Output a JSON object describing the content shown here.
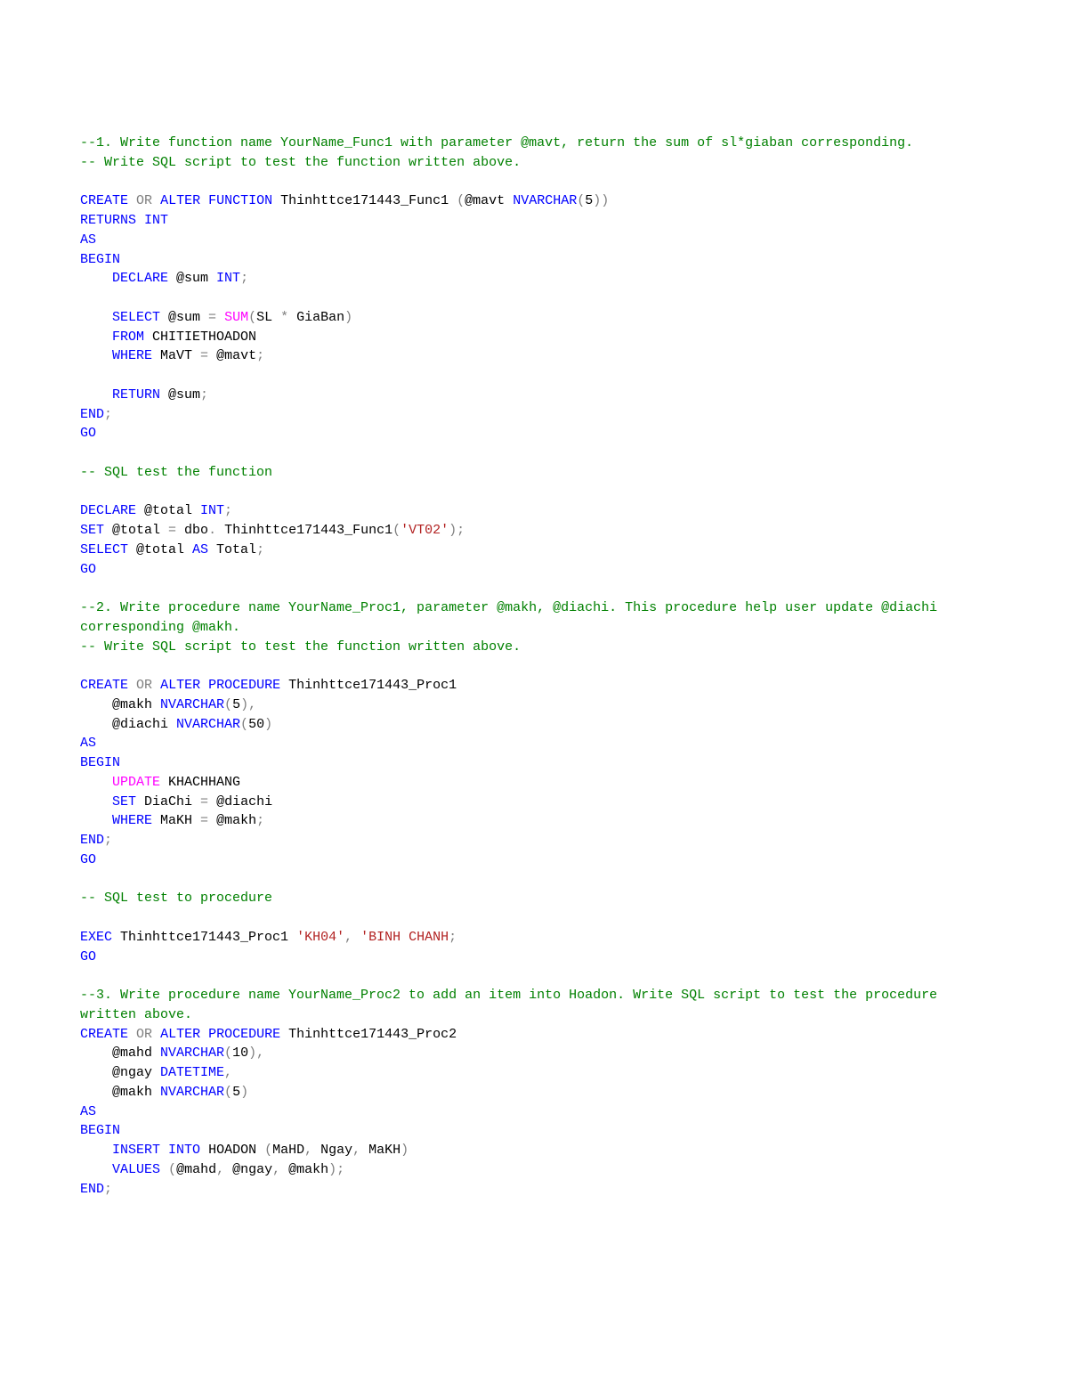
{
  "lines": [
    [
      {
        "c": "cmt",
        "t": "--1. Write function name YourName_Func1 with parameter @mavt, return the sum of sl*giaban corresponding."
      }
    ],
    [
      {
        "c": "cmt",
        "t": "-- Write SQL script to test the function written above."
      }
    ],
    [
      {
        "c": "txt",
        "t": ""
      }
    ],
    [
      {
        "c": "kw",
        "t": "CREATE"
      },
      {
        "c": "txt",
        "t": " "
      },
      {
        "c": "gr",
        "t": "OR"
      },
      {
        "c": "txt",
        "t": " "
      },
      {
        "c": "kw",
        "t": "ALTER"
      },
      {
        "c": "txt",
        "t": " "
      },
      {
        "c": "kw",
        "t": "FUNCTION"
      },
      {
        "c": "txt",
        "t": " Thinhttce171443_Func1 "
      },
      {
        "c": "gr",
        "t": "("
      },
      {
        "c": "txt",
        "t": "@mavt "
      },
      {
        "c": "kw",
        "t": "NVARCHAR"
      },
      {
        "c": "gr",
        "t": "("
      },
      {
        "c": "txt",
        "t": "5"
      },
      {
        "c": "gr",
        "t": "))"
      }
    ],
    [
      {
        "c": "kw",
        "t": "RETURNS"
      },
      {
        "c": "txt",
        "t": " "
      },
      {
        "c": "kw",
        "t": "INT"
      }
    ],
    [
      {
        "c": "kw",
        "t": "AS"
      }
    ],
    [
      {
        "c": "kw",
        "t": "BEGIN"
      }
    ],
    [
      {
        "c": "txt",
        "t": "    "
      },
      {
        "c": "kw",
        "t": "DECLARE"
      },
      {
        "c": "txt",
        "t": " @sum "
      },
      {
        "c": "kw",
        "t": "INT"
      },
      {
        "c": "gr",
        "t": ";"
      }
    ],
    [
      {
        "c": "txt",
        "t": ""
      }
    ],
    [
      {
        "c": "txt",
        "t": "    "
      },
      {
        "c": "kw",
        "t": "SELECT"
      },
      {
        "c": "txt",
        "t": " @sum "
      },
      {
        "c": "gr",
        "t": "="
      },
      {
        "c": "txt",
        "t": " "
      },
      {
        "c": "fn",
        "t": "SUM"
      },
      {
        "c": "gr",
        "t": "("
      },
      {
        "c": "txt",
        "t": "SL "
      },
      {
        "c": "gr",
        "t": "*"
      },
      {
        "c": "txt",
        "t": " GiaBan"
      },
      {
        "c": "gr",
        "t": ")"
      }
    ],
    [
      {
        "c": "txt",
        "t": "    "
      },
      {
        "c": "kw",
        "t": "FROM"
      },
      {
        "c": "txt",
        "t": " CHITIETHOADON"
      }
    ],
    [
      {
        "c": "txt",
        "t": "    "
      },
      {
        "c": "kw",
        "t": "WHERE"
      },
      {
        "c": "txt",
        "t": " MaVT "
      },
      {
        "c": "gr",
        "t": "="
      },
      {
        "c": "txt",
        "t": " @mavt"
      },
      {
        "c": "gr",
        "t": ";"
      }
    ],
    [
      {
        "c": "txt",
        "t": ""
      }
    ],
    [
      {
        "c": "txt",
        "t": "    "
      },
      {
        "c": "kw",
        "t": "RETURN"
      },
      {
        "c": "txt",
        "t": " @sum"
      },
      {
        "c": "gr",
        "t": ";"
      }
    ],
    [
      {
        "c": "kw",
        "t": "END"
      },
      {
        "c": "gr",
        "t": ";"
      }
    ],
    [
      {
        "c": "kw",
        "t": "GO"
      }
    ],
    [
      {
        "c": "txt",
        "t": ""
      }
    ],
    [
      {
        "c": "cmt",
        "t": "-- SQL test the function"
      }
    ],
    [
      {
        "c": "txt",
        "t": ""
      }
    ],
    [
      {
        "c": "kw",
        "t": "DECLARE"
      },
      {
        "c": "txt",
        "t": " @total "
      },
      {
        "c": "kw",
        "t": "INT"
      },
      {
        "c": "gr",
        "t": ";"
      }
    ],
    [
      {
        "c": "kw",
        "t": "SET"
      },
      {
        "c": "txt",
        "t": " @total "
      },
      {
        "c": "gr",
        "t": "="
      },
      {
        "c": "txt",
        "t": " dbo"
      },
      {
        "c": "gr",
        "t": "."
      },
      {
        "c": "txt",
        "t": " Thinhttce171443_Func1"
      },
      {
        "c": "gr",
        "t": "("
      },
      {
        "c": "str",
        "t": "'VT02'"
      },
      {
        "c": "gr",
        "t": ");"
      }
    ],
    [
      {
        "c": "kw",
        "t": "SELECT"
      },
      {
        "c": "txt",
        "t": " @total "
      },
      {
        "c": "kw",
        "t": "AS"
      },
      {
        "c": "txt",
        "t": " Total"
      },
      {
        "c": "gr",
        "t": ";"
      }
    ],
    [
      {
        "c": "kw",
        "t": "GO"
      }
    ],
    [
      {
        "c": "txt",
        "t": ""
      }
    ],
    [
      {
        "c": "cmt",
        "t": "--2. Write procedure name YourName_Proc1, parameter @makh, @diachi. This procedure help user update @diachi corresponding @makh."
      }
    ],
    [
      {
        "c": "cmt",
        "t": "-- Write SQL script to test the function written above."
      }
    ],
    [
      {
        "c": "txt",
        "t": ""
      }
    ],
    [
      {
        "c": "kw",
        "t": "CREATE"
      },
      {
        "c": "txt",
        "t": " "
      },
      {
        "c": "gr",
        "t": "OR"
      },
      {
        "c": "txt",
        "t": " "
      },
      {
        "c": "kw",
        "t": "ALTER"
      },
      {
        "c": "txt",
        "t": " "
      },
      {
        "c": "kw",
        "t": "PROCEDURE"
      },
      {
        "c": "txt",
        "t": " Thinhttce171443_Proc1"
      }
    ],
    [
      {
        "c": "txt",
        "t": "    @makh "
      },
      {
        "c": "kw",
        "t": "NVARCHAR"
      },
      {
        "c": "gr",
        "t": "("
      },
      {
        "c": "txt",
        "t": "5"
      },
      {
        "c": "gr",
        "t": "),"
      }
    ],
    [
      {
        "c": "txt",
        "t": "    @diachi "
      },
      {
        "c": "kw",
        "t": "NVARCHAR"
      },
      {
        "c": "gr",
        "t": "("
      },
      {
        "c": "txt",
        "t": "50"
      },
      {
        "c": "gr",
        "t": ")"
      }
    ],
    [
      {
        "c": "kw",
        "t": "AS"
      }
    ],
    [
      {
        "c": "kw",
        "t": "BEGIN"
      }
    ],
    [
      {
        "c": "txt",
        "t": "    "
      },
      {
        "c": "fn",
        "t": "UPDATE"
      },
      {
        "c": "txt",
        "t": " KHACHHANG"
      }
    ],
    [
      {
        "c": "txt",
        "t": "    "
      },
      {
        "c": "kw",
        "t": "SET"
      },
      {
        "c": "txt",
        "t": " DiaChi "
      },
      {
        "c": "gr",
        "t": "="
      },
      {
        "c": "txt",
        "t": " @diachi"
      }
    ],
    [
      {
        "c": "txt",
        "t": "    "
      },
      {
        "c": "kw",
        "t": "WHERE"
      },
      {
        "c": "txt",
        "t": " MaKH "
      },
      {
        "c": "gr",
        "t": "="
      },
      {
        "c": "txt",
        "t": " @makh"
      },
      {
        "c": "gr",
        "t": ";"
      }
    ],
    [
      {
        "c": "kw",
        "t": "END"
      },
      {
        "c": "gr",
        "t": ";"
      }
    ],
    [
      {
        "c": "kw",
        "t": "GO"
      }
    ],
    [
      {
        "c": "txt",
        "t": ""
      }
    ],
    [
      {
        "c": "cmt",
        "t": "-- SQL test to procedure"
      }
    ],
    [
      {
        "c": "txt",
        "t": ""
      }
    ],
    [
      {
        "c": "kw",
        "t": "EXEC"
      },
      {
        "c": "txt",
        "t": " Thinhttce171443_Proc1 "
      },
      {
        "c": "str",
        "t": "'KH04'"
      },
      {
        "c": "gr",
        "t": ","
      },
      {
        "c": "txt",
        "t": " "
      },
      {
        "c": "str",
        "t": "'BINH CHANH"
      },
      {
        "c": "gr",
        "t": ";"
      }
    ],
    [
      {
        "c": "kw",
        "t": "GO"
      }
    ],
    [
      {
        "c": "txt",
        "t": ""
      }
    ],
    [
      {
        "c": "cmt",
        "t": "--3. Write procedure name YourName_Proc2 to add an item into Hoadon. Write SQL script to test the procedure written above."
      }
    ],
    [
      {
        "c": "kw",
        "t": "CREATE"
      },
      {
        "c": "txt",
        "t": " "
      },
      {
        "c": "gr",
        "t": "OR"
      },
      {
        "c": "txt",
        "t": " "
      },
      {
        "c": "kw",
        "t": "ALTER"
      },
      {
        "c": "txt",
        "t": " "
      },
      {
        "c": "kw",
        "t": "PROCEDURE"
      },
      {
        "c": "txt",
        "t": " Thinhttce171443_Proc2"
      }
    ],
    [
      {
        "c": "txt",
        "t": "    @mahd "
      },
      {
        "c": "kw",
        "t": "NVARCHAR"
      },
      {
        "c": "gr",
        "t": "("
      },
      {
        "c": "txt",
        "t": "10"
      },
      {
        "c": "gr",
        "t": "),"
      }
    ],
    [
      {
        "c": "txt",
        "t": "    @ngay "
      },
      {
        "c": "kw",
        "t": "DATETIME"
      },
      {
        "c": "gr",
        "t": ","
      }
    ],
    [
      {
        "c": "txt",
        "t": "    @makh "
      },
      {
        "c": "kw",
        "t": "NVARCHAR"
      },
      {
        "c": "gr",
        "t": "("
      },
      {
        "c": "txt",
        "t": "5"
      },
      {
        "c": "gr",
        "t": ")"
      }
    ],
    [
      {
        "c": "kw",
        "t": "AS"
      }
    ],
    [
      {
        "c": "kw",
        "t": "BEGIN"
      }
    ],
    [
      {
        "c": "txt",
        "t": "    "
      },
      {
        "c": "kw",
        "t": "INSERT"
      },
      {
        "c": "txt",
        "t": " "
      },
      {
        "c": "kw",
        "t": "INTO"
      },
      {
        "c": "txt",
        "t": " HOADON "
      },
      {
        "c": "gr",
        "t": "("
      },
      {
        "c": "txt",
        "t": "MaHD"
      },
      {
        "c": "gr",
        "t": ","
      },
      {
        "c": "txt",
        "t": " Ngay"
      },
      {
        "c": "gr",
        "t": ","
      },
      {
        "c": "txt",
        "t": " MaKH"
      },
      {
        "c": "gr",
        "t": ")"
      }
    ],
    [
      {
        "c": "txt",
        "t": "    "
      },
      {
        "c": "kw",
        "t": "VALUES"
      },
      {
        "c": "txt",
        "t": " "
      },
      {
        "c": "gr",
        "t": "("
      },
      {
        "c": "txt",
        "t": "@mahd"
      },
      {
        "c": "gr",
        "t": ","
      },
      {
        "c": "txt",
        "t": " @ngay"
      },
      {
        "c": "gr",
        "t": ","
      },
      {
        "c": "txt",
        "t": " @makh"
      },
      {
        "c": "gr",
        "t": ");"
      }
    ],
    [
      {
        "c": "kw",
        "t": "END"
      },
      {
        "c": "gr",
        "t": ";"
      }
    ]
  ]
}
